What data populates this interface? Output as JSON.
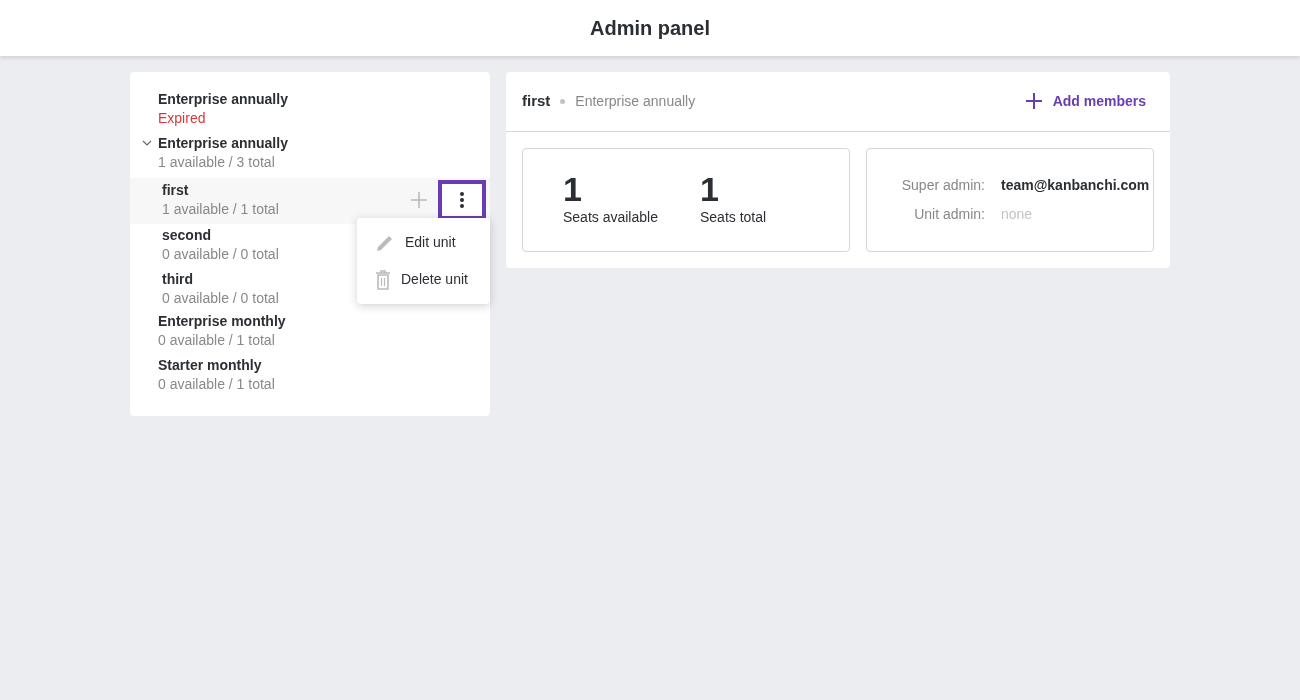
{
  "header": {
    "title": "Admin panel"
  },
  "subscriptions": [
    {
      "name": "Enterprise annually",
      "kind": "expired",
      "status": "Expired"
    },
    {
      "name": "Enterprise annually",
      "kind": "seats",
      "status": "1 available / 3 total",
      "expanded": true,
      "children": [
        {
          "name": "first",
          "status": "1 available / 1 total",
          "selected": true,
          "menu_open": true
        },
        {
          "name": "second",
          "status": "0 available / 0 total",
          "selected": false,
          "menu_open": false
        },
        {
          "name": "third",
          "status": "0 available / 0 total",
          "selected": false,
          "menu_open": false
        }
      ]
    },
    {
      "name": "Enterprise monthly",
      "kind": "seats",
      "status": "0 available / 1 total"
    },
    {
      "name": "Starter monthly",
      "kind": "seats",
      "status": "0 available / 1 total"
    }
  ],
  "unit_menu": [
    "Edit unit",
    "Delete unit"
  ],
  "detail": {
    "unit": "first",
    "plan": "Enterprise annually",
    "add_button": "Add members",
    "stats": [
      {
        "value": "1",
        "label": "Seats available"
      },
      {
        "value": "1",
        "label": "Seats total"
      }
    ],
    "admins": [
      {
        "label": "Super admin:",
        "value": "team@kanbanchi.com",
        "kind": "set"
      },
      {
        "label": "Unit admin:",
        "value": "none",
        "kind": "empty"
      }
    ]
  }
}
